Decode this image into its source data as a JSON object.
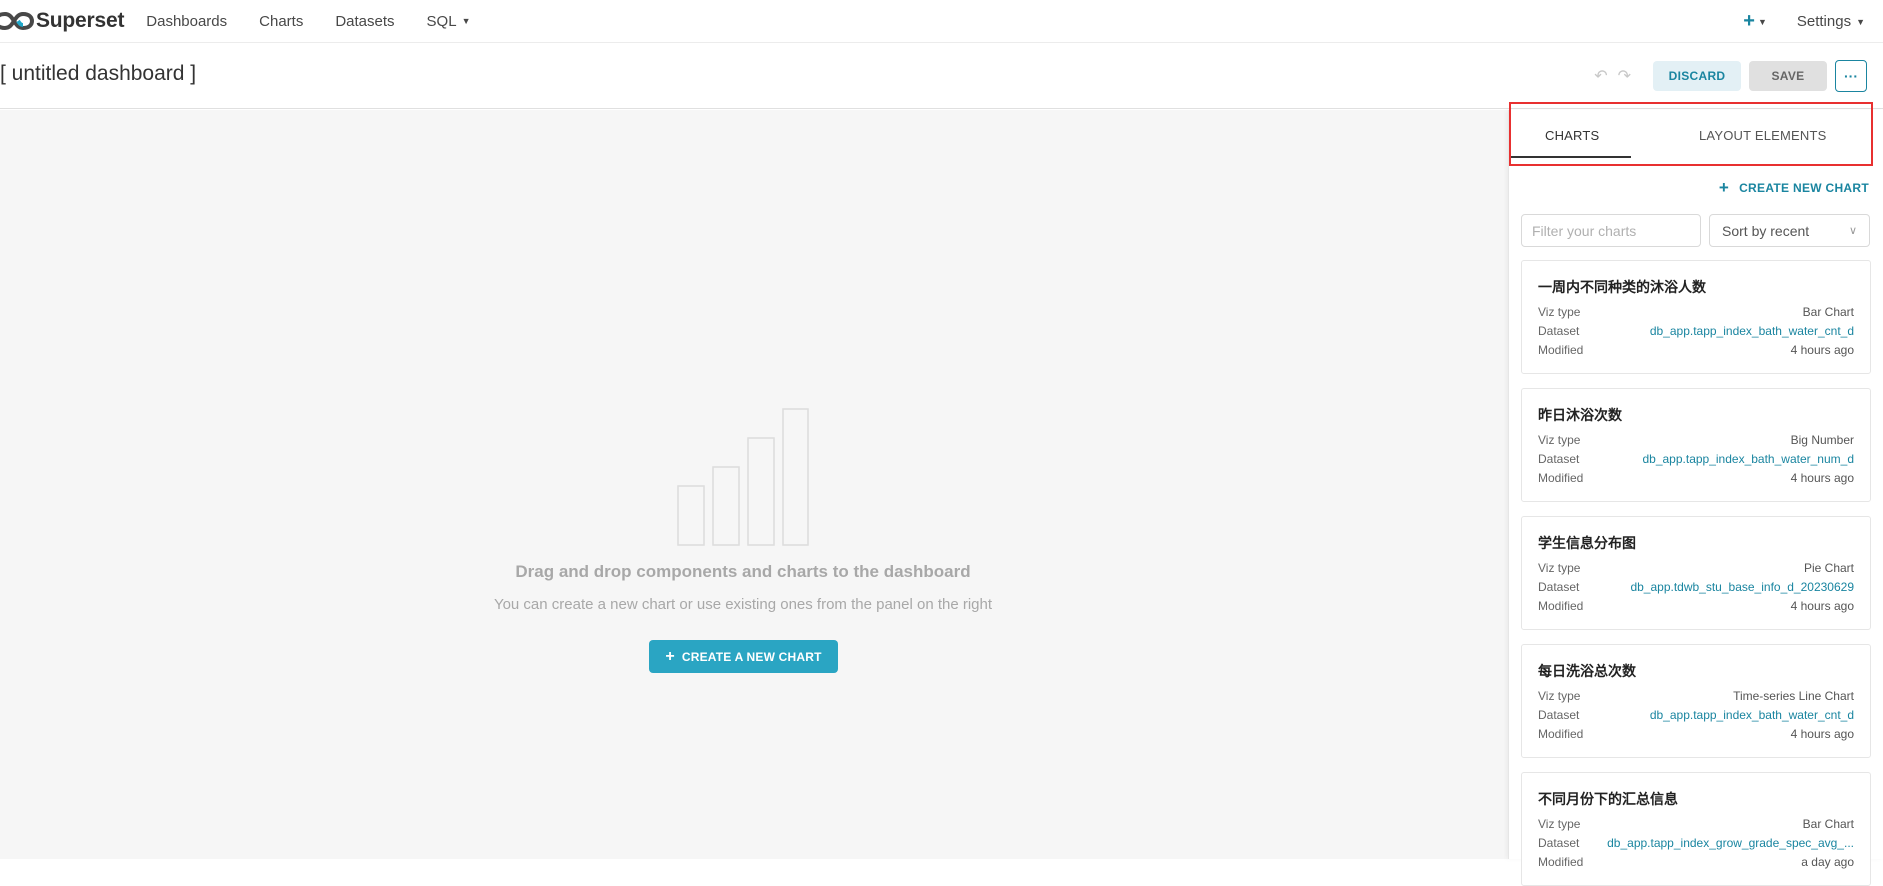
{
  "nav": {
    "brand": "Superset",
    "items": [
      "Dashboards",
      "Charts",
      "Datasets",
      "SQL"
    ],
    "settings": "Settings"
  },
  "header": {
    "title": "[ untitled dashboard ]",
    "discard": "DISCARD",
    "save": "SAVE",
    "more": "···"
  },
  "empty": {
    "title": "Drag and drop components and charts to the dashboard",
    "subtitle": "You can create a new chart or use existing ones from the panel on the right",
    "button": "CREATE A NEW CHART"
  },
  "panel": {
    "tabs": [
      "CHARTS",
      "LAYOUT ELEMENTS"
    ],
    "create_link": "CREATE NEW CHART",
    "filter_placeholder": "Filter your charts",
    "sort_value": "Sort by recent",
    "labels": {
      "viz": "Viz type",
      "dataset": "Dataset",
      "modified": "Modified"
    },
    "charts": [
      {
        "title": "一周内不同种类的沐浴人数",
        "viz": "Bar Chart",
        "dataset": "db_app.tapp_index_bath_water_cnt_d",
        "modified": "4 hours ago"
      },
      {
        "title": "昨日沐浴次数",
        "viz": "Big Number",
        "dataset": "db_app.tapp_index_bath_water_num_d",
        "modified": "4 hours ago"
      },
      {
        "title": "学生信息分布图",
        "viz": "Pie Chart",
        "dataset": "db_app.tdwb_stu_base_info_d_20230629",
        "modified": "4 hours ago"
      },
      {
        "title": "每日洗浴总次数",
        "viz": "Time-series Line Chart",
        "dataset": "db_app.tapp_index_bath_water_cnt_d",
        "modified": "4 hours ago"
      },
      {
        "title": "不同月份下的汇总信息",
        "viz": "Bar Chart",
        "dataset": "db_app.tapp_index_grow_grade_spec_avg_...",
        "modified": "a day ago"
      }
    ]
  },
  "colors": {
    "accent": "#1a85a0",
    "primary_button": "#2aa5c3",
    "highlight_box": "#e83030"
  }
}
